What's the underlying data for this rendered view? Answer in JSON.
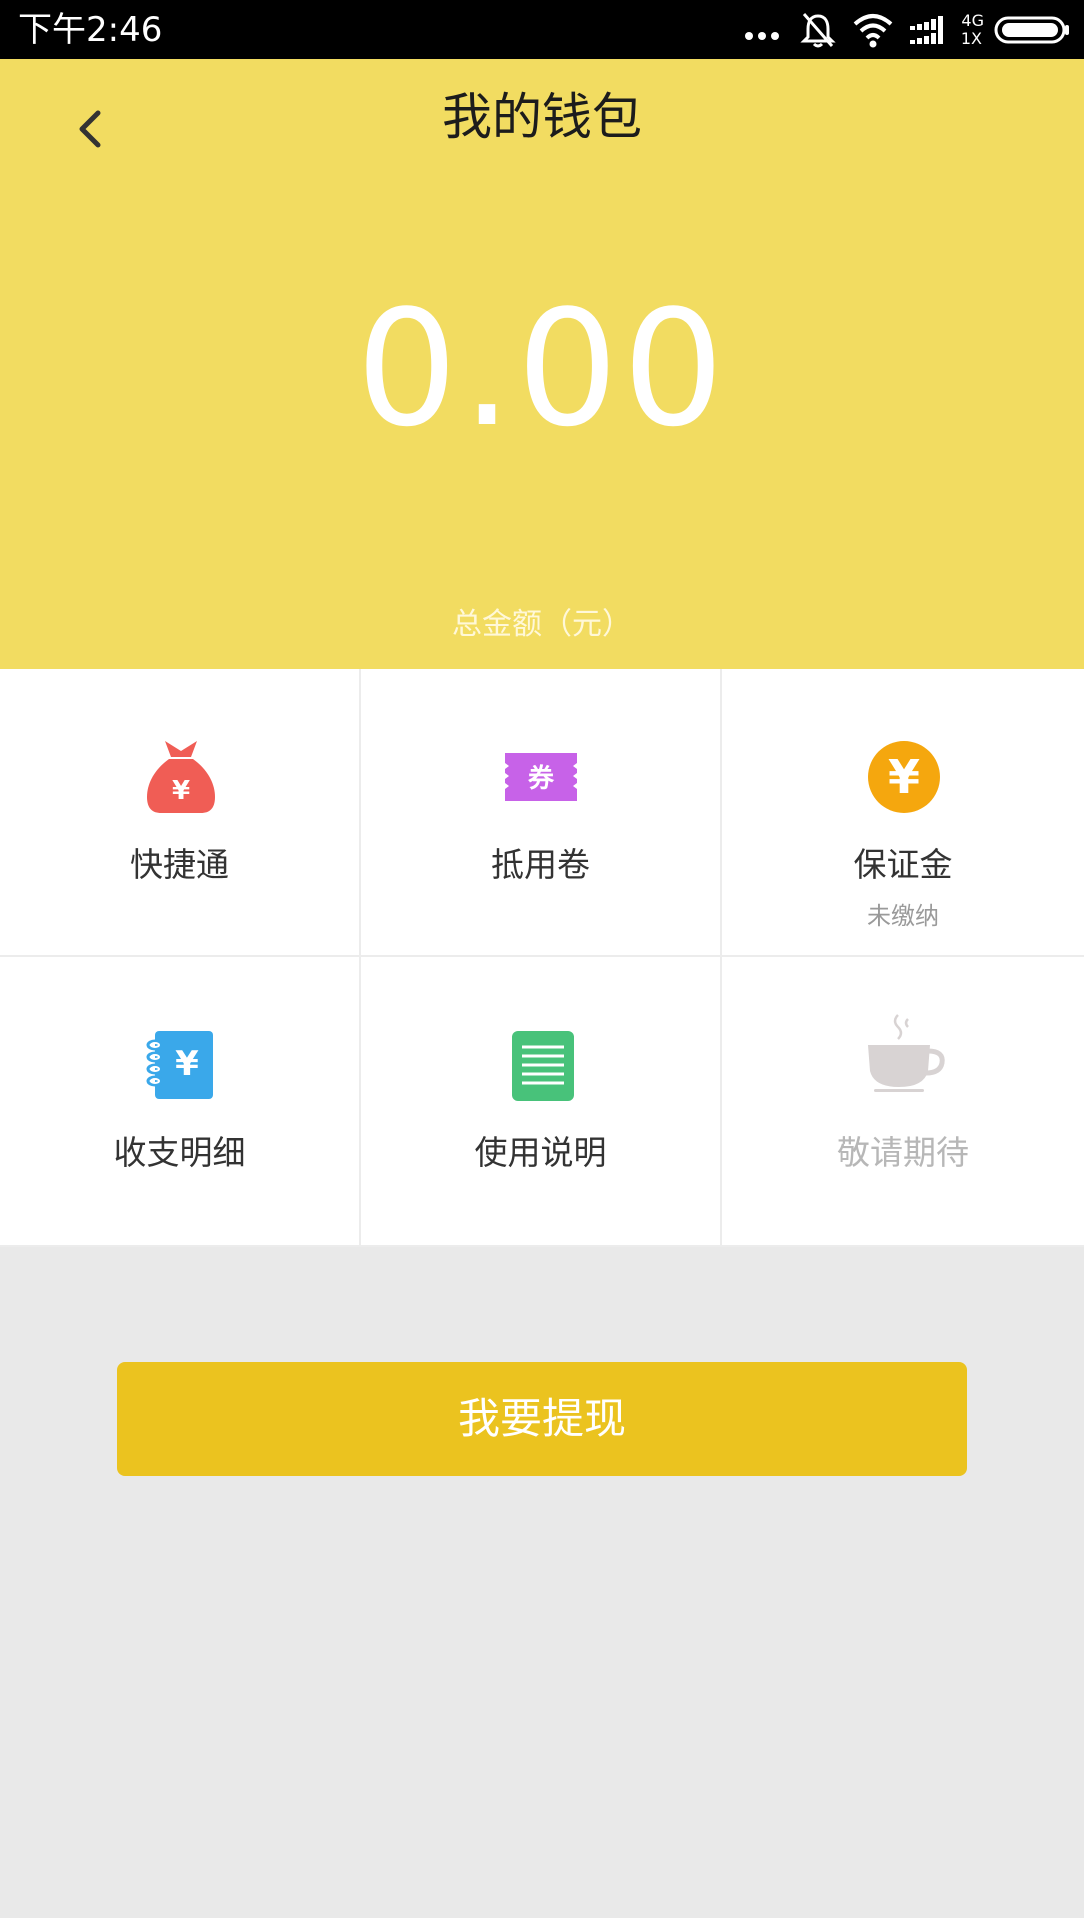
{
  "status_bar": {
    "time": "下午2:46",
    "network": "4G",
    "network_sub": "1X"
  },
  "header": {
    "title": "我的钱包",
    "amount": "0.00",
    "amount_label": "总金额（元）"
  },
  "grid": {
    "items": [
      {
        "label": "快捷通",
        "icon": "money-bag-icon",
        "color": "#f05d55"
      },
      {
        "label": "抵用卷",
        "icon": "coupon-icon",
        "icon_text": "券",
        "color": "#c762e8"
      },
      {
        "label": "保证金",
        "sub": "未缴纳",
        "icon": "yen-coin-icon",
        "color": "#f5a70e"
      },
      {
        "label": "收支明细",
        "icon": "ledger-icon",
        "color": "#3aa8ea"
      },
      {
        "label": "使用说明",
        "icon": "document-icon",
        "color": "#48c27a"
      },
      {
        "label": "敬请期待",
        "icon": "coffee-cup-icon",
        "color": "#d8d3d3"
      }
    ]
  },
  "withdraw": {
    "label": "我要提现",
    "color": "#ebc31f"
  },
  "colors": {
    "header": "#f2dc61",
    "background": "#e9e9e9"
  }
}
